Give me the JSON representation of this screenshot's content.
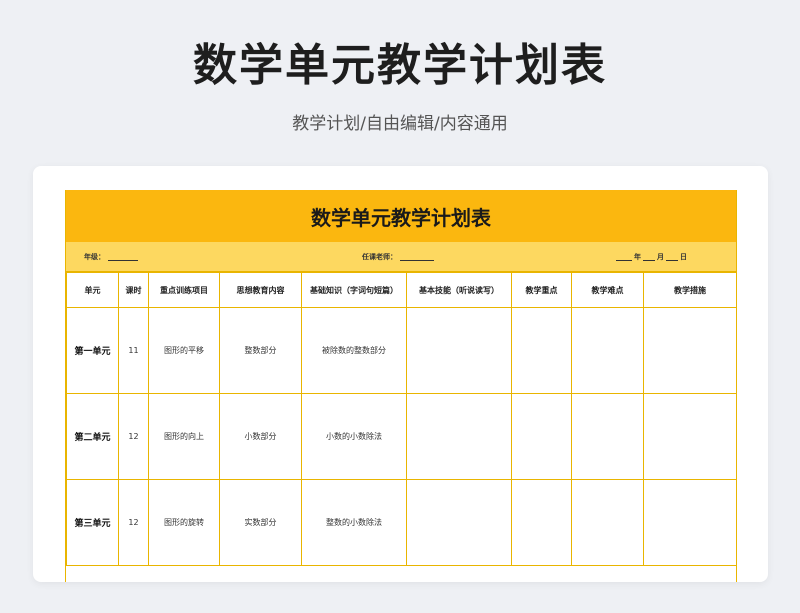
{
  "page": {
    "title": "数学单元教学计划表",
    "subtitle": "教学计划/自由编辑/内容通用"
  },
  "sheet": {
    "title": "数学单元教学计划表",
    "info": {
      "grade_label": "年级：",
      "teacher_label": "任课老师：",
      "year_label": "年",
      "month_label": "月",
      "day_label": "日"
    },
    "headers": [
      "单元",
      "课时",
      "重点训练项目",
      "思想教育内容",
      "基础知识（字词句短篇）",
      "基本技能（听说读写）",
      "教学重点",
      "教学难点",
      "教学措施"
    ],
    "rows": [
      {
        "unit": "第一单元",
        "hours": "11",
        "training": "图形的平移",
        "ideology": "整数部分",
        "basics": "被除数的整数部分",
        "skills": "",
        "key": "",
        "difficulty": "",
        "measures": ""
      },
      {
        "unit": "第二单元",
        "hours": "12",
        "training": "图形的向上",
        "ideology": "小数部分",
        "basics": "小数的小数除法",
        "skills": "",
        "key": "",
        "difficulty": "",
        "measures": ""
      },
      {
        "unit": "第三单元",
        "hours": "12",
        "training": "图形的旋转",
        "ideology": "实数部分",
        "basics": "整数的小数除法",
        "skills": "",
        "key": "",
        "difficulty": "",
        "measures": ""
      }
    ]
  },
  "colors": {
    "title_bar": "#fbb70f",
    "info_bar": "#fdd860",
    "border": "#e9b500",
    "background": "#eef0f4"
  }
}
